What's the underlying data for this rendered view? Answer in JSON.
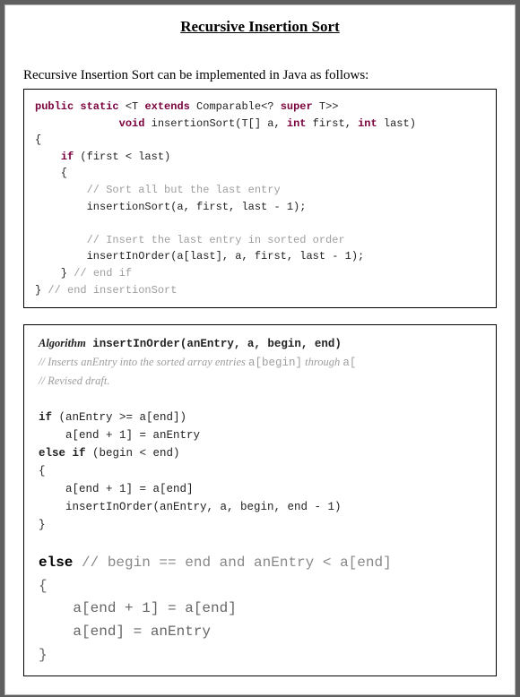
{
  "title": "Recursive Insertion Sort",
  "intro": "Recursive Insertion Sort can be implemented in Java as follows:",
  "code1": {
    "l1a": "public static ",
    "l1b": "<T ",
    "l1kw2": "extends",
    "l1c": " Comparable<? ",
    "l1kw3": "super",
    "l1d": " T>>",
    "l2a": "             ",
    "l2kw": "void",
    "l2b": " insertionSort(T[] a, ",
    "l2kw2": "int",
    "l2c": " first, ",
    "l2kw3": "int",
    "l2d": " last)",
    "l3": "{",
    "l4a": "    ",
    "l4kw": "if",
    "l4b": " (first < last)",
    "l5": "    {",
    "l6": "        // Sort all but the last entry",
    "l7": "        insertionSort(a, first, last - 1);",
    "l8": "",
    "l9": "        // Insert the last entry in sorted order",
    "l10": "        insertInOrder(a[last], a, first, last - 1);",
    "l11a": "    } ",
    "l11c": "// end if",
    "l12a": "} ",
    "l12c": "// end insertionSort"
  },
  "code2": {
    "h1a": "Algorithm",
    "h1b": " insertInOrder(anEntry, a, begin, end)",
    "c1a": "// Inserts anEntry into the sorted array entries ",
    "c1b": "a[begin]",
    "c1c": " through ",
    "c1d": "a[",
    "c2": "// Revised draft.",
    "l1a": "if",
    "l1b": " (anEntry >= a[end])",
    "l2": "    a[end + 1] = anEntry",
    "l3a": "else if",
    "l3b": " (begin < end)",
    "l4": "{",
    "l5": "    a[end + 1] = a[end]",
    "l6": "    insertInOrder(anEntry, a, begin, end - 1)",
    "l7": "}",
    "l8": "",
    "b1a": "else ",
    "b1b": "// begin == end and anEntry < a[end]",
    "b2": "{",
    "b3": "    a[end + 1] = a[end]",
    "b4": "    a[end] = anEntry",
    "b5": "}"
  }
}
